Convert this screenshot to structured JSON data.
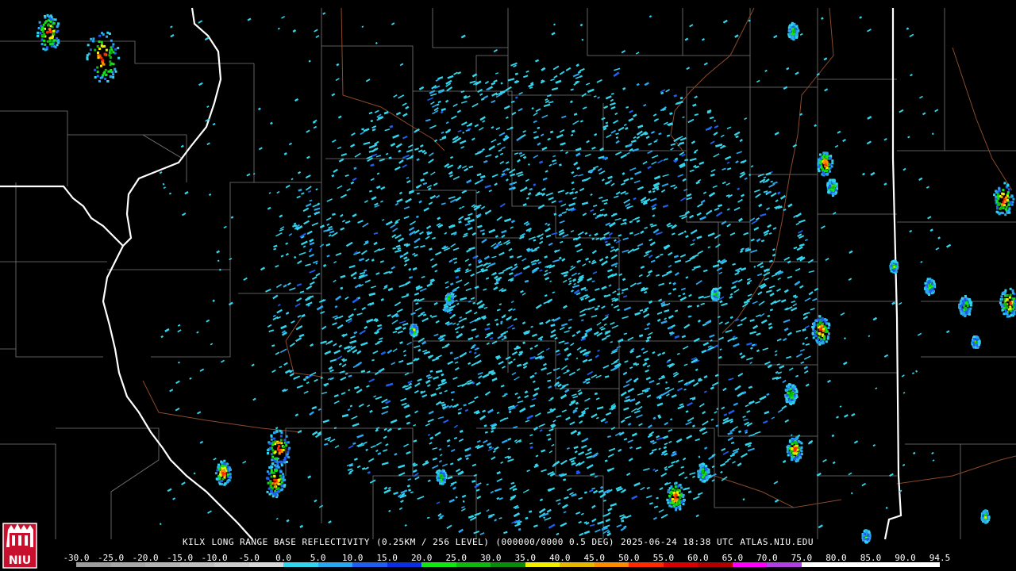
{
  "product": {
    "station": "KILX",
    "title": "LONG RANGE BASE REFLECTIVITY",
    "resolution": "(0.25KM / 256 LEVEL)",
    "volume": "(000000/0000 0.5 DEG)",
    "timestamp": "2025-06-24 18:38 UTC",
    "source": "ATLAS.NIU.EDU"
  },
  "logo": {
    "text": "NIU"
  },
  "colorbar": {
    "ticks": [
      "-30.0",
      "-25.0",
      "-20.0",
      "-15.0",
      "-10.0",
      "-5.0",
      "0.0",
      "5.0",
      "10.0",
      "15.0",
      "20.0",
      "25.0",
      "30.0",
      "35.0",
      "40.0",
      "45.0",
      "50.0",
      "55.0",
      "60.0",
      "65.0",
      "70.0",
      "75.0",
      "80.0",
      "85.0",
      "90.0",
      "94.5"
    ],
    "colors": [
      "#9e9e9e",
      "#a8a8a8",
      "#b4b4b4",
      "#c0c0c0",
      "#cccccc",
      "#d8d8d8",
      "#31d6ee",
      "#29a8f0",
      "#1e5ff0",
      "#0a2ee0",
      "#14e614",
      "#10b810",
      "#0b8a0b",
      "#f0f000",
      "#e8b800",
      "#ff8c00",
      "#ff2a00",
      "#d80000",
      "#b00000",
      "#ff00ff",
      "#b040e0",
      "#ffffff",
      "#ffffff",
      "#ffffff",
      "#ffffff"
    ]
  },
  "map_colors": {
    "background": "#000000",
    "state_border": "#ffffff",
    "county_border": "#808080",
    "river": "#8b4a2a"
  }
}
